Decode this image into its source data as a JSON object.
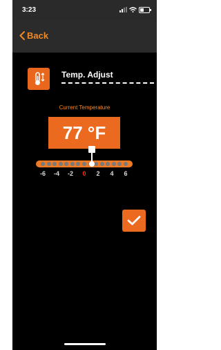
{
  "status_bar": {
    "time": "3:23",
    "battery_level": 0.45
  },
  "nav": {
    "back_label": "Back"
  },
  "header": {
    "title": "Temp. Adjust",
    "icon": "thermometer-icon"
  },
  "current_temperature": {
    "label": "Current Temperature",
    "value": "77 °F"
  },
  "slider": {
    "ticks": [
      "-6",
      "-4",
      "-2",
      "0",
      "2",
      "4",
      "6"
    ],
    "selected": "0"
  },
  "confirm": {
    "icon": "checkmark-icon"
  },
  "colors": {
    "accent": "#EC6A1F",
    "highlight": "#FF2A1A",
    "background": "#000000"
  }
}
